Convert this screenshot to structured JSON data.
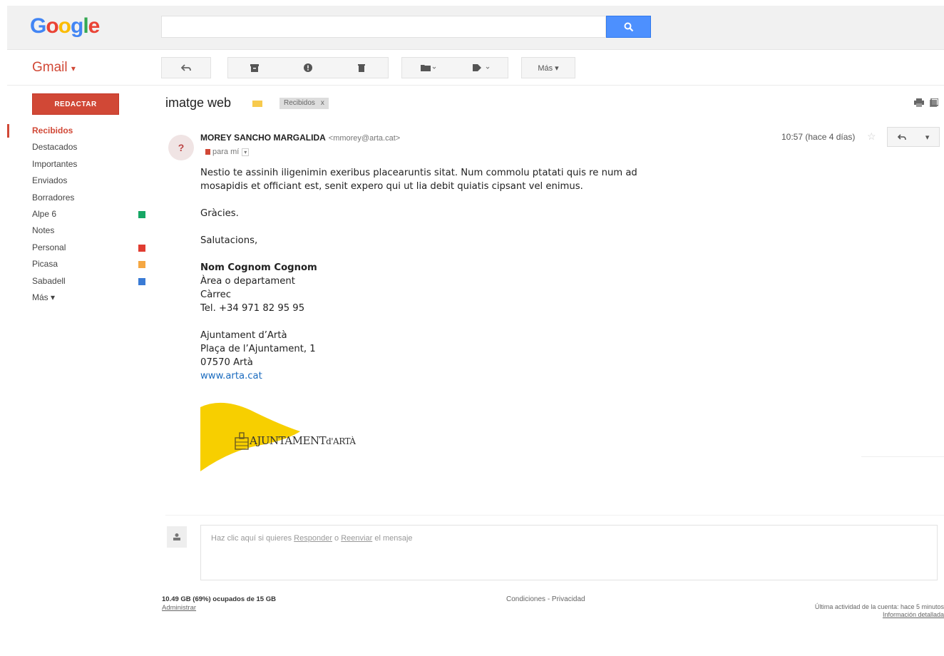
{
  "header": {
    "logo": [
      "G",
      "o",
      "o",
      "g",
      "l",
      "e"
    ],
    "logo_colors": [
      "#4285f4",
      "#ea4335",
      "#fbbc05",
      "#4285f4",
      "#34a853",
      "#ea4335"
    ],
    "search_value": "",
    "search_icon": "search-icon",
    "accent": "#4d90fe"
  },
  "subbar": {
    "app_label": "Gmail",
    "app_caret": "▾",
    "more_label": "Más ▾"
  },
  "sidebar": {
    "compose_label": "REDACTAR",
    "items": [
      {
        "label": "Recibidos",
        "active": true,
        "color": ""
      },
      {
        "label": "Destacados",
        "active": false,
        "color": ""
      },
      {
        "label": "Importantes",
        "active": false,
        "color": ""
      },
      {
        "label": "Enviados",
        "active": false,
        "color": ""
      },
      {
        "label": "Borradores",
        "active": false,
        "color": ""
      },
      {
        "label": "Alpe 6",
        "active": false,
        "color": "#16a765"
      },
      {
        "label": "Notes",
        "active": false,
        "color": ""
      },
      {
        "label": "Personal",
        "active": false,
        "color": "#e03c31"
      },
      {
        "label": "Picasa",
        "active": false,
        "color": "#f5a742"
      },
      {
        "label": "Sabadell",
        "active": false,
        "color": "#3a7bd5"
      },
      {
        "label": "Más ▾",
        "active": false,
        "color": ""
      }
    ]
  },
  "email": {
    "subject": "imatge web",
    "inbox_badge": "Recibidos",
    "inbox_badge_close": "x",
    "sender_name": "MOREY SANCHO MARGALIDA",
    "sender_email": "<mmorey@arta.cat>",
    "to": "para mí",
    "time": "10:57 (hace 4 días)",
    "body": {
      "para1": "Nestio te assinih iligenimin exeribus placearuntis sitat. Num commolu ptatati quis re num ad mosapidis et officiant est, senit expero qui ut lia debit quiatis cipsant vel enimus.",
      "thanks": "Gràcies.",
      "greeting": "Salutacions,",
      "sig_name": "Nom Cognom Cognom",
      "sig_area": "Àrea o departament",
      "sig_role": "Càrrec",
      "sig_tel": "Tel. +34 971 82 95 95",
      "org": "Ajuntament d’Artà",
      "address": "Plaça de l’Ajuntament, 1",
      "city": "07570 Artà",
      "web": "www.arta.cat"
    },
    "brand_text": "AJUNTAMENT",
    "brand_text_suffix": "d'ARTÀ",
    "brand_color": "#f7cf00"
  },
  "reply": {
    "prefix": "Haz clic aquí si quieres ",
    "reply_link": "Responder",
    "middle": " o ",
    "forward_link": "Reenviar",
    "suffix": " el mensaje"
  },
  "footer": {
    "storage": "10.49 GB (69%) ocupados de 15 GB",
    "manage": "Administrar",
    "terms": "Condiciones - Privacidad",
    "activity": "Última actividad de la cuenta: hace 5 minutos",
    "details": "Información detallada"
  }
}
